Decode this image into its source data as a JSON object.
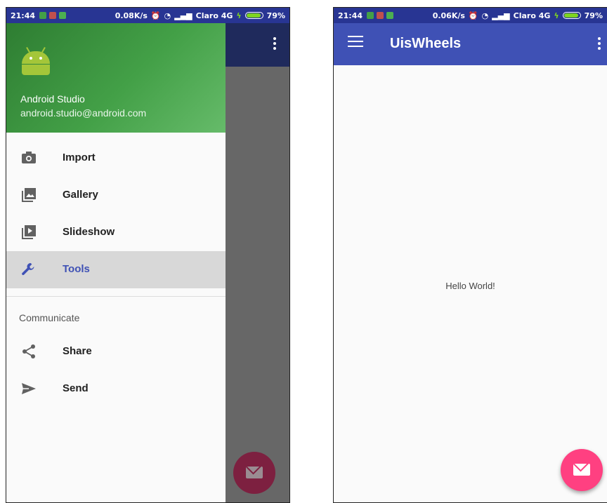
{
  "left": {
    "status": {
      "time": "21:44",
      "speed": "0.08K/s",
      "carrier": "Claro 4G",
      "battery": "79%"
    },
    "drawer": {
      "name": "Android Studio",
      "email": "android.studio@android.com",
      "items": [
        {
          "label": "Import",
          "icon": "camera-icon"
        },
        {
          "label": "Gallery",
          "icon": "gallery-icon"
        },
        {
          "label": "Slideshow",
          "icon": "slideshow-icon"
        },
        {
          "label": "Tools",
          "icon": "wrench-icon",
          "selected": true
        }
      ],
      "section": "Communicate",
      "section_items": [
        {
          "label": "Share",
          "icon": "share-icon"
        },
        {
          "label": "Send",
          "icon": "send-icon"
        }
      ]
    }
  },
  "right": {
    "status": {
      "time": "21:44",
      "speed": "0.06K/s",
      "carrier": "Claro 4G",
      "battery": "79%"
    },
    "appbar": {
      "title": "UisWheels"
    },
    "content": {
      "text": "Hello World!"
    }
  },
  "colors": {
    "primary": "#3f51b5",
    "status": "#283593",
    "accent": "#ff4081",
    "drawer_header": "#43a047"
  }
}
